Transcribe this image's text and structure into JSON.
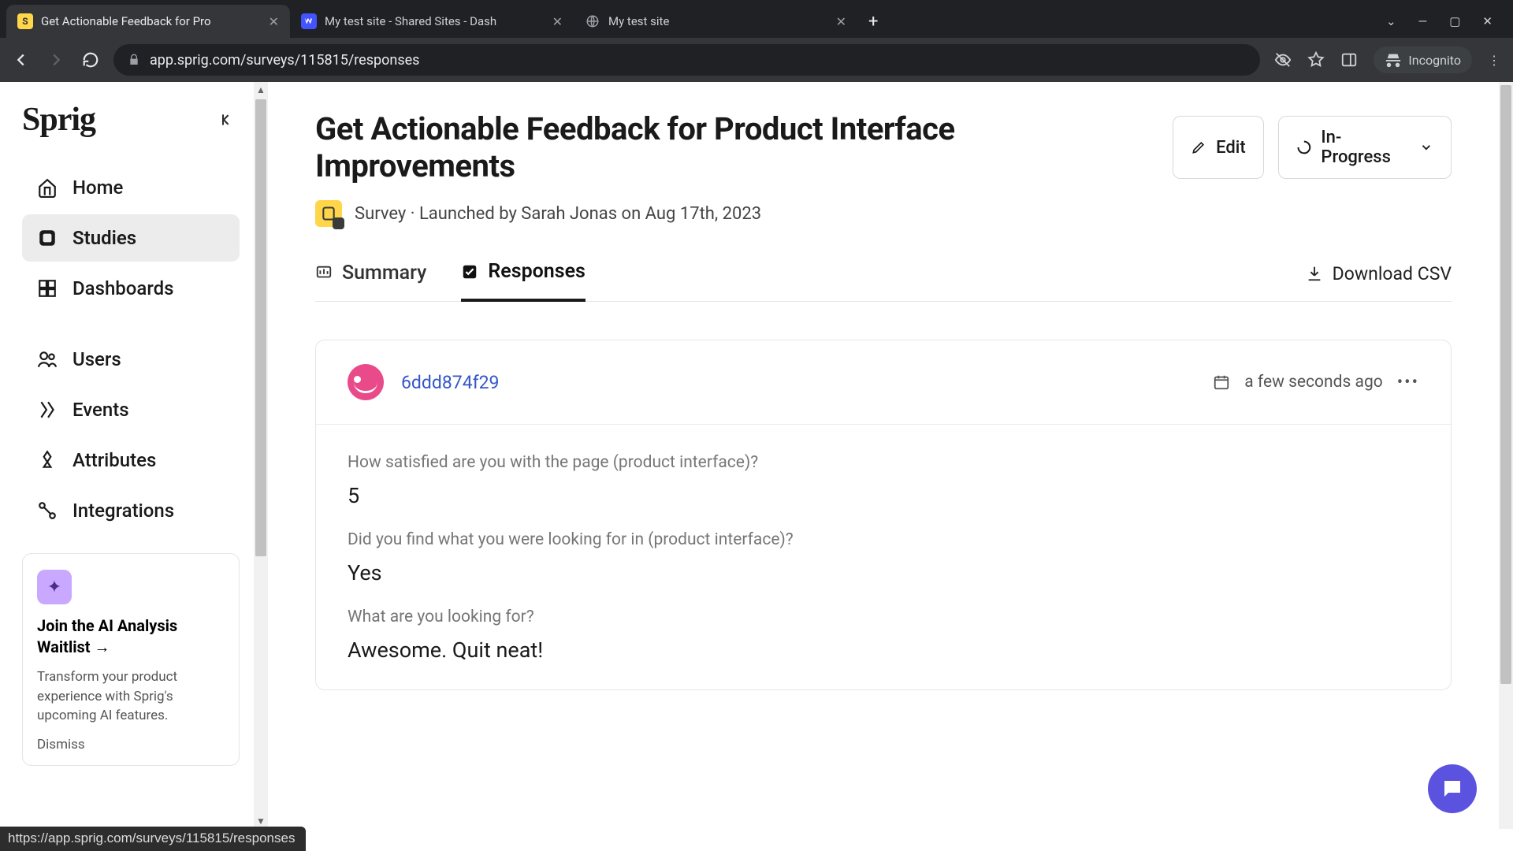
{
  "browser": {
    "tabs": [
      {
        "title": "Get Actionable Feedback for Pro"
      },
      {
        "title": "My test site - Shared Sites - Dash"
      },
      {
        "title": "My test site"
      }
    ],
    "url": "app.sprig.com/surveys/115815/responses",
    "incognito_label": "Incognito",
    "status_link": "https://app.sprig.com/surveys/115815/responses"
  },
  "sidebar": {
    "logo": "Sprig",
    "items": [
      {
        "label": "Home"
      },
      {
        "label": "Studies"
      },
      {
        "label": "Dashboards"
      },
      {
        "label": "Users"
      },
      {
        "label": "Events"
      },
      {
        "label": "Attributes"
      },
      {
        "label": "Integrations"
      }
    ],
    "promo": {
      "title": "Join the AI Analysis Waitlist →",
      "body": "Transform your product experience with Sprig's upcoming AI features.",
      "dismiss": "Dismiss"
    }
  },
  "header": {
    "title": "Get Actionable Feedback for Product Interface Improvements",
    "edit": "Edit",
    "status": "In-Progress",
    "meta": "Survey · Launched by Sarah Jonas on Aug 17th, 2023"
  },
  "tabs": {
    "summary": "Summary",
    "responses": "Responses",
    "download": "Download CSV"
  },
  "response": {
    "id": "6ddd874f29",
    "time": "a few seconds ago",
    "qa": [
      {
        "q": "How satisfied are you with the page (product interface)?",
        "a": "5"
      },
      {
        "q": "Did you find what you were looking for in (product interface)?",
        "a": "Yes"
      },
      {
        "q": "What are you looking for?",
        "a": "Awesome. Quit neat!"
      }
    ]
  }
}
